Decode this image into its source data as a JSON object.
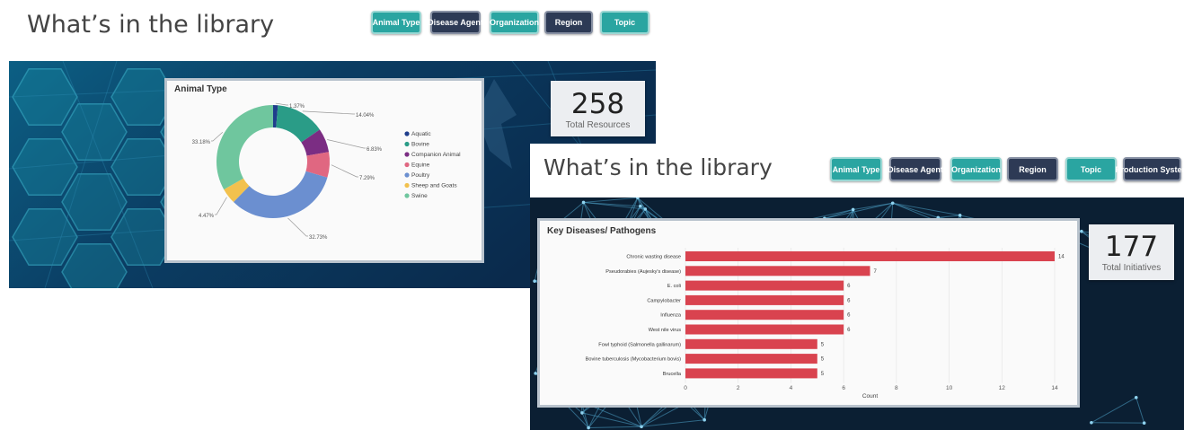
{
  "panel1": {
    "heading": "What’s in the library",
    "filters": [
      {
        "label": "Animal Type",
        "style": "teal"
      },
      {
        "label": "Disease Agent",
        "style": "navy"
      },
      {
        "label": "Organization",
        "style": "teal"
      },
      {
        "label": "Region",
        "style": "navy"
      },
      {
        "label": "Topic",
        "style": "teal"
      }
    ],
    "kpi": {
      "value": "258",
      "label": "Total Resources"
    }
  },
  "panel2": {
    "heading": "What’s in the library",
    "filters": [
      {
        "label": "Animal Type",
        "style": "teal"
      },
      {
        "label": "Disease Agent",
        "style": "navy"
      },
      {
        "label": "Organization",
        "style": "teal"
      },
      {
        "label": "Region",
        "style": "navy"
      },
      {
        "label": "Topic",
        "style": "teal"
      },
      {
        "label": "Production System",
        "style": "navy"
      }
    ],
    "kpi": {
      "value": "177",
      "label": "Total Initiatives"
    }
  },
  "chart_data": [
    {
      "type": "pie",
      "title": "Animal Type",
      "donut": true,
      "legend_position": "right",
      "slices": [
        {
          "name": "Aquatic",
          "value": 1.37,
          "label": "1.37%",
          "color": "#1f3e8c"
        },
        {
          "name": "Bovine",
          "value": 14.04,
          "label": "14.04%",
          "color": "#2a9c87"
        },
        {
          "name": "Companion Animal",
          "value": 6.83,
          "label": "6.83%",
          "color": "#7b2d83"
        },
        {
          "name": "Equine",
          "value": 7.29,
          "label": "7.29%",
          "color": "#e06781"
        },
        {
          "name": "Poultry",
          "value": 32.73,
          "label": "32.73%",
          "color": "#6b8fd0"
        },
        {
          "name": "Sheep and Goats",
          "value": 4.47,
          "label": "4.47%",
          "color": "#f2c14e"
        },
        {
          "name": "Swine",
          "value": 33.18,
          "label": "33.18%",
          "color": "#6fc69e"
        }
      ]
    },
    {
      "type": "bar",
      "orientation": "horizontal",
      "title": "Key Diseases/ Pathogens",
      "categories": [
        "Chronic wasting disease",
        "Pseudorabies (Aujesky's disease)",
        "E. coli",
        "Campylobacter",
        "Influenza",
        "West nile virus",
        "Fowl typhoid (Salmonella gallinarum)",
        "Bovine tuberculosis (Mycobacterium bovis)",
        "Brucella"
      ],
      "values": [
        14,
        7,
        6,
        6,
        6,
        6,
        5,
        5,
        5
      ],
      "xlabel": "Count",
      "xlim": [
        0,
        14
      ],
      "xticks": [
        "0",
        "2",
        "4",
        "6",
        "8",
        "10",
        "12",
        "14"
      ],
      "bar_color": "#d9434f"
    }
  ]
}
